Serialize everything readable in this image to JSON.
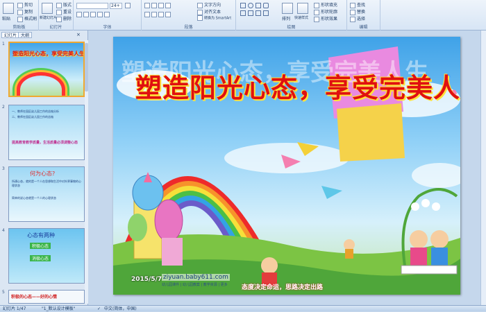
{
  "ribbon": {
    "clipboard": {
      "paste": "粘贴",
      "cut": "剪切",
      "copy": "复制",
      "format_painter": "格式刷",
      "group": "剪贴板"
    },
    "slides": {
      "new_slide": "新建幻灯片",
      "layout": "版式",
      "reset": "重设",
      "delete": "删除",
      "group": "幻灯片"
    },
    "font": {
      "font_size": "24+",
      "group": "字体"
    },
    "paragraph": {
      "text_direction": "文字方向",
      "align_text": "对齐文本",
      "smartart": "转换为 SmartArt",
      "group": "段落"
    },
    "drawing": {
      "arrange": "排列",
      "quick_styles": "快速样式",
      "shape_fill": "形状填充",
      "shape_outline": "形状轮廓",
      "shape_effects": "形状效果",
      "group": "绘图"
    },
    "editing": {
      "find": "查找",
      "replace": "替换",
      "select": "选择",
      "group": "编辑"
    }
  },
  "left_pane": {
    "tabs": [
      "幻灯片",
      "大纲"
    ],
    "thumbnails": [
      {
        "num": "1",
        "title": "塑造阳光心态，享受完美人生"
      },
      {
        "num": "2",
        "lines": [
          "一、教师在园区幼儿园工作的苦恼分析",
          "二、教师在园区幼儿园工作的苦恼",
          "提高教育教学质量，生活质量必须调整心态"
        ]
      },
      {
        "num": "3",
        "title": "何为心态?",
        "lines": [
          "所谓心态，就的是一个人在思想和生活中对外界事物的心理状态",
          "简单的说心态就是一个人的心理状态"
        ]
      },
      {
        "num": "4",
        "title": "心态有两种",
        "lines": [
          "积极心态",
          "消极心态"
        ]
      },
      {
        "num": "5",
        "title": "积极的心态——好的心情"
      }
    ]
  },
  "slide": {
    "title": "塑造阳光心态，享受完美人生",
    "background_text": "塑造阳光心态，享受完美人生",
    "date": "2015/5/7",
    "website": "ziyuan.baby611.com",
    "footer_small": "幼儿园课件 | 幼儿园教案 | 教学资源 | 更多",
    "motto": "态度决定命运，思路决定出路"
  },
  "status": {
    "slide_info": "幻灯片 1/47",
    "theme": "\"1_默认设计模板\"",
    "language": "中文(简体，中国)"
  },
  "colors": {
    "title_red": "#e01010",
    "title_outline": "#ffe23a",
    "selected_border": "#f0a830"
  }
}
